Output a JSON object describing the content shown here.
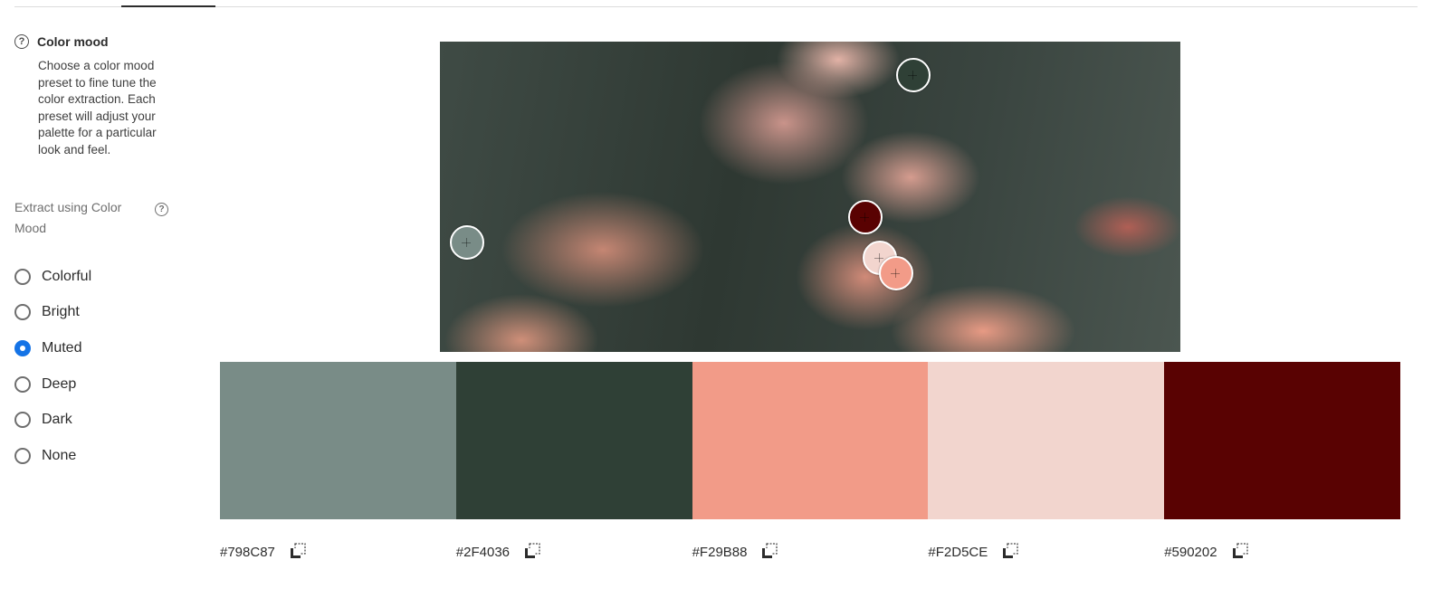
{
  "sidebar": {
    "mood_title": "Color mood",
    "mood_description": "Choose a color mood preset to fine tune the color extraction. Each preset will adjust your palette for a particular look and feel.",
    "extract_label": "Extract using Color Mood",
    "help_glyph": "?",
    "options": [
      {
        "label": "Colorful",
        "checked": false
      },
      {
        "label": "Bright",
        "checked": false
      },
      {
        "label": "Muted",
        "checked": true
      },
      {
        "label": "Deep",
        "checked": false
      },
      {
        "label": "Dark",
        "checked": false
      },
      {
        "label": "None",
        "checked": false
      }
    ],
    "accent_color": "#1473e6"
  },
  "palette": [
    {
      "hex": "#798C87",
      "color": "#798C87"
    },
    {
      "hex": "#2F4036",
      "color": "#2F4036"
    },
    {
      "hex": "#F29B88",
      "color": "#F29B88"
    },
    {
      "hex": "#F2D5CE",
      "color": "#F2D5CE"
    },
    {
      "hex": "#590202",
      "color": "#590202"
    }
  ],
  "pickers": [
    {
      "color": "#2F4036"
    },
    {
      "color": "#798C87"
    },
    {
      "color": "#590202"
    },
    {
      "color": "#F2D5CE"
    },
    {
      "color": "#F29B88"
    }
  ]
}
